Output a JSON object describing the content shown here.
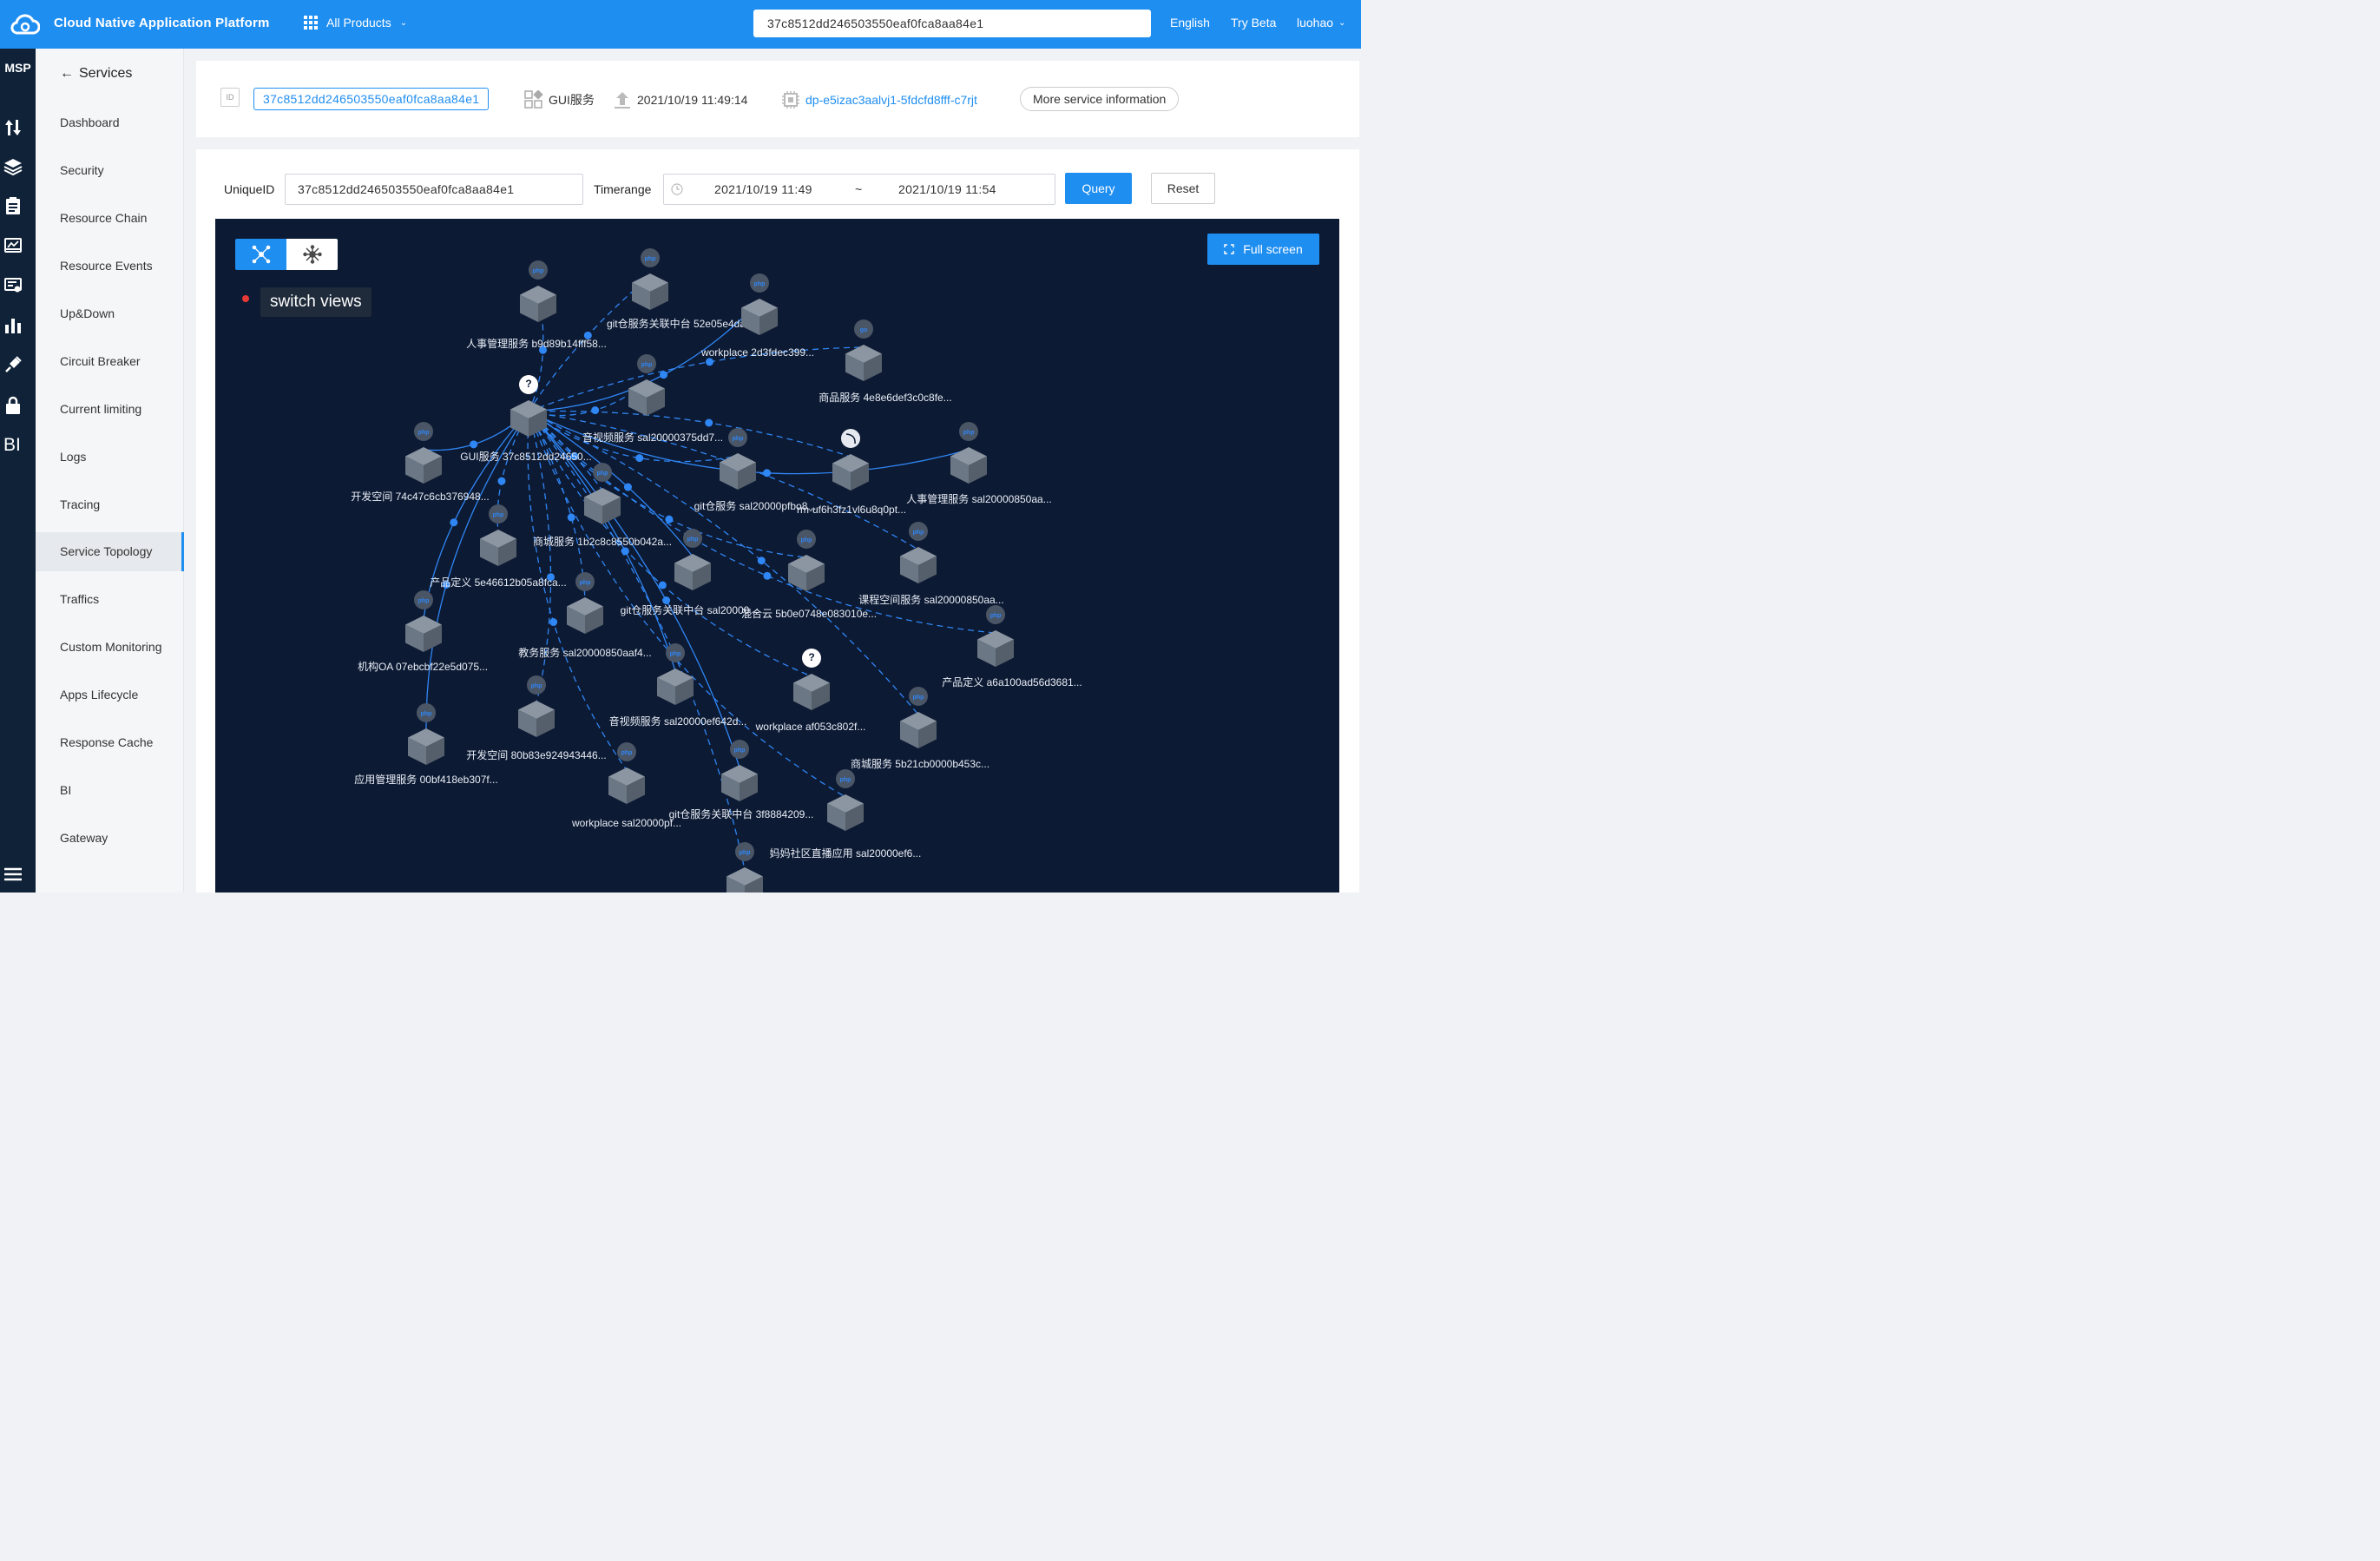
{
  "topbar": {
    "title": "Cloud Native Application Platform",
    "all_products": "All Products",
    "search_value": "37c8512dd246503550eaf0fca8aa84e1",
    "language": "English",
    "try_beta": "Try Beta",
    "user": "luohao",
    "icons": [
      "cloud-logo-icon",
      "grid-icon",
      "chevron-down-icon"
    ]
  },
  "rail": {
    "label": "MSP",
    "icons": [
      "sort-arrows-icon",
      "layers-icon",
      "clipboard-icon",
      "monitor-icon",
      "certificate-icon",
      "bar-chart-icon",
      "plug-icon",
      "lock-icon",
      "bi-icon",
      "menu-icon"
    ]
  },
  "sidebar": {
    "back_label": "Services",
    "items": [
      {
        "label": "Dashboard"
      },
      {
        "label": "Security"
      },
      {
        "label": "Resource Chain"
      },
      {
        "label": "Resource Events"
      },
      {
        "label": "Up&Down"
      },
      {
        "label": "Circuit Breaker"
      },
      {
        "label": "Current limiting"
      },
      {
        "label": "Logs"
      },
      {
        "label": "Tracing"
      },
      {
        "label": "Service Topology",
        "active": true
      },
      {
        "label": "Traffics"
      },
      {
        "label": "Custom Monitoring"
      },
      {
        "label": "Apps Lifecycle"
      },
      {
        "label": "Response Cache"
      },
      {
        "label": "BI"
      },
      {
        "label": "Gateway"
      }
    ]
  },
  "service_info": {
    "id_badge": "ID",
    "id": "37c8512dd246503550eaf0fca8aa84e1",
    "name": "GUI服务",
    "updated": "2021/10/19 11:49:14",
    "deployment": "dp-e5izac3aalvj1-5fdcfd8fff-c7rjt",
    "more": "More service information"
  },
  "query": {
    "unique_id_label": "UniqueID",
    "unique_id_value": "37c8512dd246503550eaf0fca8aa84e1",
    "timerange_label": "Timerange",
    "time_start": "2021/10/19 11:49",
    "time_sep": "~",
    "time_end": "2021/10/19 11:54",
    "query_button": "Query",
    "reset_button": "Reset"
  },
  "topology": {
    "hint": "switch views",
    "fullscreen_button": "Full screen",
    "colors": {
      "background": "#0d1a33",
      "edge": "#2f86f5",
      "node": "#6b7785",
      "accent": "#1f8ef1"
    },
    "center": "GUI服务 37c8512dd24650...",
    "nodes": [
      {
        "id": "gui",
        "label": "GUI服务 37c8512dd24650...",
        "badge": "?"
      },
      {
        "id": "n1",
        "label": "人事管理服务 b9d89b14fff58...",
        "badge": "php"
      },
      {
        "id": "n2",
        "label": "git仓服务关联中台 52e05e4da...",
        "badge": "php"
      },
      {
        "id": "n3",
        "label": "workplace 2d3fdec399...",
        "badge": "php"
      },
      {
        "id": "n4",
        "label": "商品服务 4e8e6def3c0c8fe...",
        "badge": "go"
      },
      {
        "id": "n5",
        "label": "音视频服务 sal20000375dd7...",
        "badge": "php"
      },
      {
        "id": "n6",
        "label": "开发空间 74c47c6cb376948...",
        "badge": "php"
      },
      {
        "id": "n7",
        "label": "git仓服务 sal20000pfbo8...",
        "badge": "php"
      },
      {
        "id": "n8",
        "label": "rm-uf6h3fz1vl6u8q0pt...",
        "badge": "db"
      },
      {
        "id": "n9",
        "label": "人事管理服务 sal20000850aa...",
        "badge": "php"
      },
      {
        "id": "n10",
        "label": "商城服务 1b2c8c8550b042a...",
        "badge": "php"
      },
      {
        "id": "n11",
        "label": "产品定义 5e46612b05a8fca...",
        "badge": "php"
      },
      {
        "id": "n12",
        "label": "git仓服务关联中台 sal20000...",
        "badge": "php"
      },
      {
        "id": "n13",
        "label": "混合云 5b0e0748e083010e...",
        "badge": "php"
      },
      {
        "id": "n14",
        "label": "课程空间服务 sal20000850aa...",
        "badge": "php"
      },
      {
        "id": "n15",
        "label": "机构OA 07ebcbf22e5d075...",
        "badge": "php"
      },
      {
        "id": "n16",
        "label": "教务服务 sal20000850aaf4...",
        "badge": "php"
      },
      {
        "id": "n17",
        "label": "产品定义 a6a100ad56d3681...",
        "badge": "php"
      },
      {
        "id": "n18",
        "label": "音视频服务 sal20000ef642d...",
        "badge": "php"
      },
      {
        "id": "n19",
        "label": "workplace af053c802f...",
        "badge": "?"
      },
      {
        "id": "n20",
        "label": "开发空间 80b83e924943446...",
        "badge": "php"
      },
      {
        "id": "n21",
        "label": "应用管理服务 00bf418eb307f...",
        "badge": "php"
      },
      {
        "id": "n22",
        "label": "商城服务 5b21cb0000b453c...",
        "badge": "php"
      },
      {
        "id": "n23",
        "label": "workplace sal20000pf...",
        "badge": "php"
      },
      {
        "id": "n24",
        "label": "git仓服务关联中台 3f8884209...",
        "badge": "php"
      },
      {
        "id": "n25",
        "label": "妈妈社区直播应用 sal20000ef6...",
        "badge": "php"
      },
      {
        "id": "n26",
        "label": "",
        "badge": "php"
      }
    ]
  }
}
